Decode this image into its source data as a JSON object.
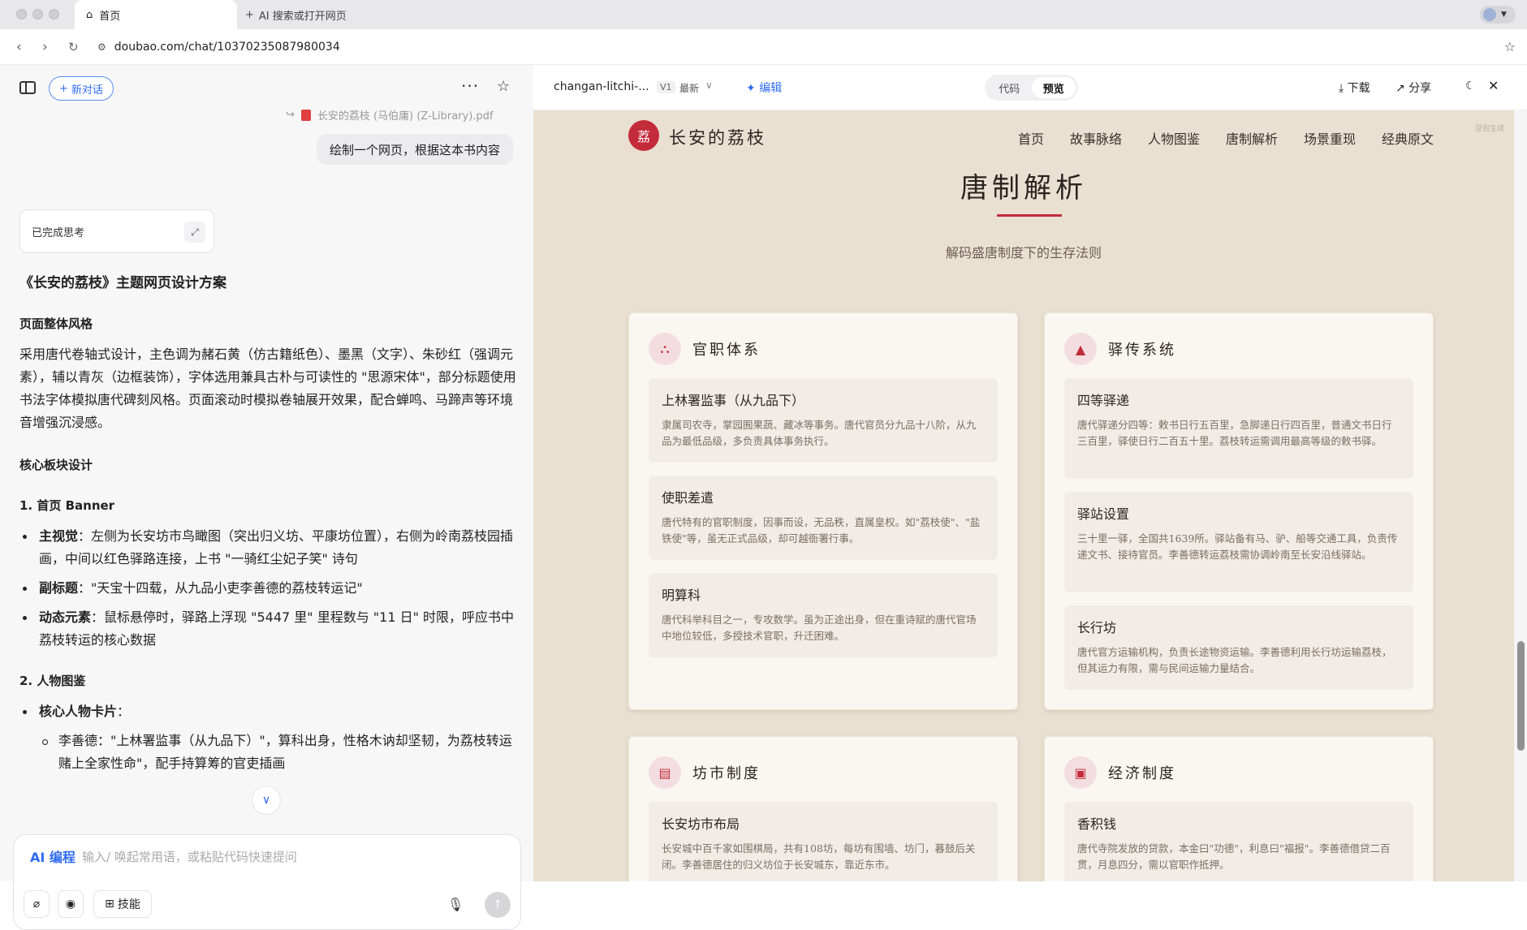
{
  "browser": {
    "tab_active": "首页",
    "tab_new": "AI 搜索或打开网页",
    "url": "doubao.com/chat/10370235087980034"
  },
  "chat": {
    "new_chat": "新对话",
    "attachment": "长安的荔枝 (马伯庸) (Z-Library).pdf",
    "user_message": "绘制一个网页，根据这本书内容",
    "thinking_done": "已完成思考",
    "title": "《长安的荔枝》主题网页设计方案",
    "h_style": "页面整体风格",
    "p_style": "采用唐代卷轴式设计，主色调为赭石黄（仿古籍纸色）、墨黑（文字）、朱砂红（强调元素），辅以青灰（边框装饰），字体选用兼具古朴与可读性的 \"思源宋体\"，部分标题使用书法字体模拟唐代碑刻风格。页面滚动时模拟卷轴展开效果，配合蝉鸣、马蹄声等环境音增强沉浸感。",
    "h_core": "核心板块设计",
    "h_banner": "1. 首页 Banner",
    "b1_label": "主视觉",
    "b1_text": "：左侧为长安坊市鸟瞰图（突出归义坊、平康坊位置），右侧为岭南荔枝园插画，中间以红色驿路连接，上书 \"一骑红尘妃子笑\" 诗句",
    "b2_label": "副标题",
    "b2_text": "：\"天宝十四载，从九品小吏李善德的荔枝转运记\"",
    "b3_label": "动态元素",
    "b3_text": "：鼠标悬停时，驿路上浮现 \"5447 里\" 里程数与 \"11 日\" 时限，呼应书中荔枝转运的核心数据",
    "h_people": "2. 人物图鉴",
    "p1_label": "核心人物卡片",
    "p1_text": "：",
    "p2_text": "李善德：\"上林署监事（从九品下）\"，算科出身，性格木讷却坚韧，为荔枝转运赌上全家性命\"，配手持算筹的官吏插画",
    "ai_tag": "AI 编程",
    "placeholder": "输入/ 唤起常用语，或粘贴代码快速提问",
    "skills": "技能"
  },
  "editor": {
    "filename": "changan-litchi-...",
    "version": "V1",
    "latest": "最新",
    "edit": "编辑",
    "tab_code": "代码",
    "tab_preview": "预览",
    "download": "下载",
    "share": "分享"
  },
  "site": {
    "logo_char": "荔",
    "brand": "长安的荔枝",
    "nav": [
      "首页",
      "故事脉络",
      "人物图鉴",
      "唐制解析",
      "场景重现",
      "经典原文"
    ],
    "watermark": "豆包生成",
    "section_title": "唐制解析",
    "section_subtitle": "解码盛唐制度下的生存法则",
    "cards": [
      {
        "icon": "hierarchy-icon",
        "title": "官职体系",
        "items": [
          {
            "t": "上林署监事（从九品下）",
            "d": "隶属司农寺，掌园囿果蔬、藏冰等事务。唐代官员分九品十八阶，从九品为最低品级，多负责具体事务执行。"
          },
          {
            "t": "使职差遣",
            "d": "唐代特有的官职制度，因事而设，无品秩，直属皇权。如\"荔枝使\"、\"盐铁使\"等，虽无正式品级，却可越衙署行事。"
          },
          {
            "t": "明算科",
            "d": "唐代科举科目之一，专攻数学。虽为正途出身，但在重诗赋的唐代官场中地位较低，多授技术官职，升迁困难。"
          }
        ]
      },
      {
        "icon": "road-icon",
        "title": "驿传系统",
        "items": [
          {
            "t": "四等驿递",
            "d": "唐代驿递分四等：敕书日行五百里，急脚递日行四百里，普通文书日行三百里，驿使日行二百五十里。荔枝转运需调用最高等级的敕书驿。"
          },
          {
            "t": "驿站设置",
            "d": "三十里一驿，全国共1639所。驿站备有马、驴、船等交通工具，负责传递文书、接待官员。李善德转运荔枝需协调岭南至长安沿线驿站。"
          },
          {
            "t": "长行坊",
            "d": "唐代官方运输机构，负责长途物资运输。李善德利用长行坊运输荔枝，但其运力有限，需与民间运输力量结合。"
          }
        ]
      },
      {
        "icon": "map-icon",
        "title": "坊市制度",
        "items": [
          {
            "t": "长安坊市布局",
            "d": "长安城中百千家如围棋局，共有108坊，每坊有围墙、坊门，暮鼓后关闭。李善德居住的归义坊位于长安城东，靠近东市。"
          }
        ]
      },
      {
        "icon": "money-icon",
        "title": "经济制度",
        "items": [
          {
            "t": "香积钱",
            "d": "唐代寺院发放的贷款，本金曰\"功德\"，利息曰\"福报\"。李善德借贷二百贯，月息四分，需以官职作抵押。"
          }
        ]
      }
    ]
  }
}
